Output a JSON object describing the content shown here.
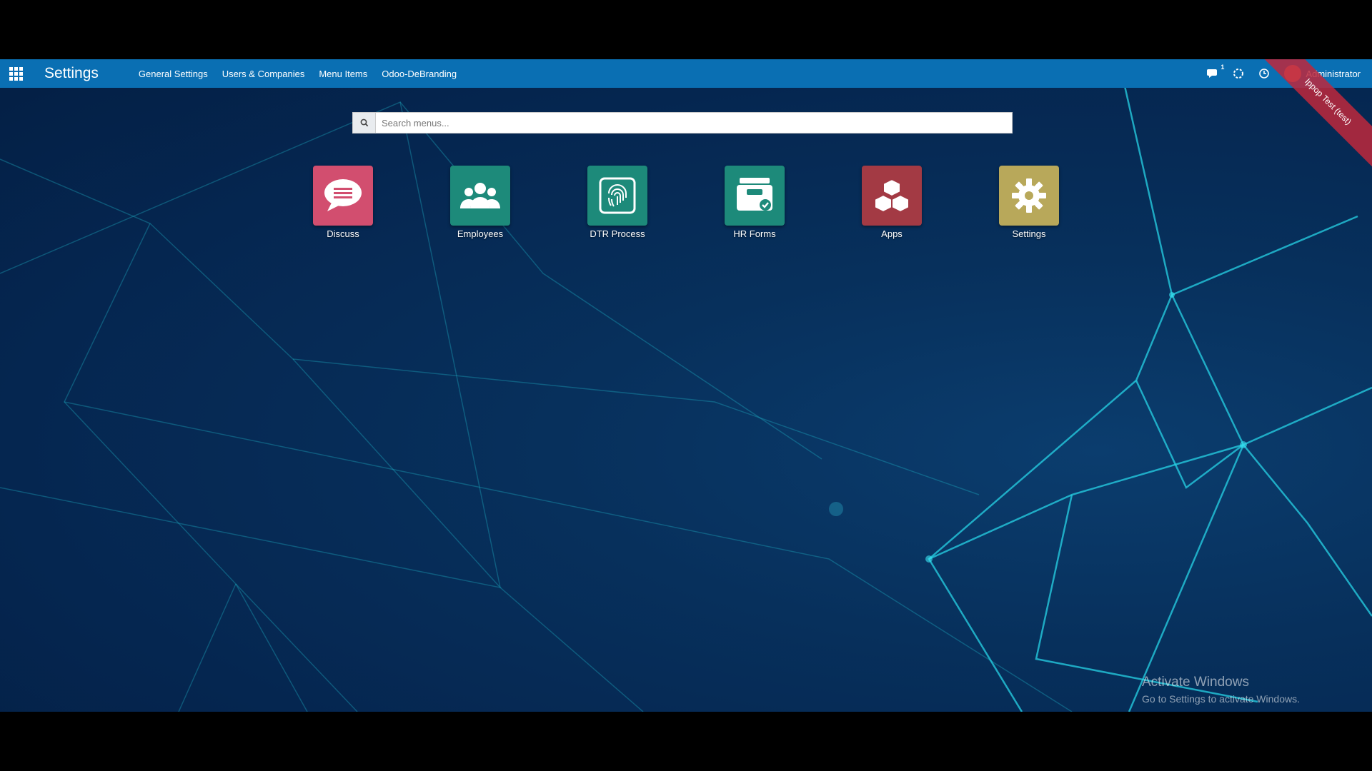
{
  "navbar": {
    "title": "Settings",
    "menu": [
      "General Settings",
      "Users & Companies",
      "Menu Items",
      "Odoo-DeBranding"
    ],
    "chat_badge": "1",
    "user_name": "Administrator",
    "ribbon": "Ippop Test (test)"
  },
  "search": {
    "placeholder": "Search menus..."
  },
  "apps": [
    {
      "label": "Discuss",
      "color": "#d24e6f",
      "icon": "chat-bubble-icon"
    },
    {
      "label": "Employees",
      "color": "#1d8a7a",
      "icon": "people-icon"
    },
    {
      "label": "DTR Process",
      "color": "#1d8a7a",
      "icon": "fingerprint-icon"
    },
    {
      "label": "HR Forms",
      "color": "#1d8a7a",
      "icon": "inbox-check-icon"
    },
    {
      "label": "Apps",
      "color": "#a33a44",
      "icon": "cubes-icon"
    },
    {
      "label": "Settings",
      "color": "#b8a85a",
      "icon": "gear-icon"
    }
  ],
  "watermark": {
    "title": "Activate Windows",
    "subtitle": "Go to Settings to activate Windows."
  }
}
